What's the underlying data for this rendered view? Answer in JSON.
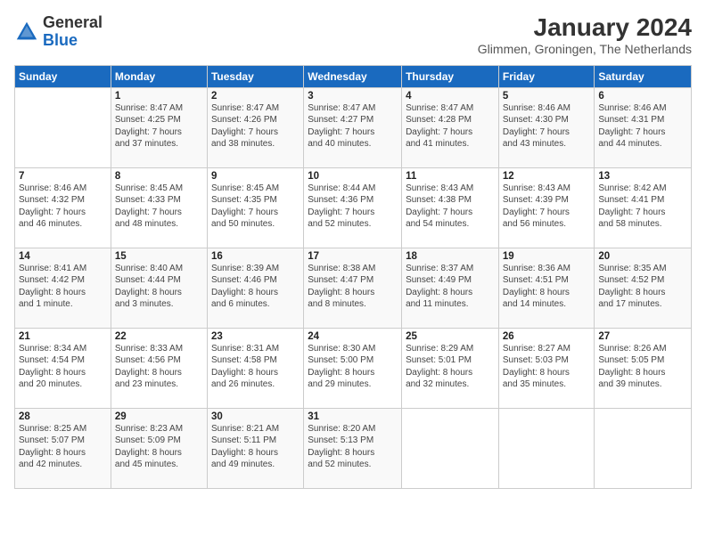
{
  "header": {
    "logo_general": "General",
    "logo_blue": "Blue",
    "title": "January 2024",
    "location": "Glimmen, Groningen, The Netherlands"
  },
  "days_of_week": [
    "Sunday",
    "Monday",
    "Tuesday",
    "Wednesday",
    "Thursday",
    "Friday",
    "Saturday"
  ],
  "weeks": [
    [
      {
        "day": "",
        "info": ""
      },
      {
        "day": "1",
        "info": "Sunrise: 8:47 AM\nSunset: 4:25 PM\nDaylight: 7 hours\nand 37 minutes."
      },
      {
        "day": "2",
        "info": "Sunrise: 8:47 AM\nSunset: 4:26 PM\nDaylight: 7 hours\nand 38 minutes."
      },
      {
        "day": "3",
        "info": "Sunrise: 8:47 AM\nSunset: 4:27 PM\nDaylight: 7 hours\nand 40 minutes."
      },
      {
        "day": "4",
        "info": "Sunrise: 8:47 AM\nSunset: 4:28 PM\nDaylight: 7 hours\nand 41 minutes."
      },
      {
        "day": "5",
        "info": "Sunrise: 8:46 AM\nSunset: 4:30 PM\nDaylight: 7 hours\nand 43 minutes."
      },
      {
        "day": "6",
        "info": "Sunrise: 8:46 AM\nSunset: 4:31 PM\nDaylight: 7 hours\nand 44 minutes."
      }
    ],
    [
      {
        "day": "7",
        "info": "Sunrise: 8:46 AM\nSunset: 4:32 PM\nDaylight: 7 hours\nand 46 minutes."
      },
      {
        "day": "8",
        "info": "Sunrise: 8:45 AM\nSunset: 4:33 PM\nDaylight: 7 hours\nand 48 minutes."
      },
      {
        "day": "9",
        "info": "Sunrise: 8:45 AM\nSunset: 4:35 PM\nDaylight: 7 hours\nand 50 minutes."
      },
      {
        "day": "10",
        "info": "Sunrise: 8:44 AM\nSunset: 4:36 PM\nDaylight: 7 hours\nand 52 minutes."
      },
      {
        "day": "11",
        "info": "Sunrise: 8:43 AM\nSunset: 4:38 PM\nDaylight: 7 hours\nand 54 minutes."
      },
      {
        "day": "12",
        "info": "Sunrise: 8:43 AM\nSunset: 4:39 PM\nDaylight: 7 hours\nand 56 minutes."
      },
      {
        "day": "13",
        "info": "Sunrise: 8:42 AM\nSunset: 4:41 PM\nDaylight: 7 hours\nand 58 minutes."
      }
    ],
    [
      {
        "day": "14",
        "info": "Sunrise: 8:41 AM\nSunset: 4:42 PM\nDaylight: 8 hours\nand 1 minute."
      },
      {
        "day": "15",
        "info": "Sunrise: 8:40 AM\nSunset: 4:44 PM\nDaylight: 8 hours\nand 3 minutes."
      },
      {
        "day": "16",
        "info": "Sunrise: 8:39 AM\nSunset: 4:46 PM\nDaylight: 8 hours\nand 6 minutes."
      },
      {
        "day": "17",
        "info": "Sunrise: 8:38 AM\nSunset: 4:47 PM\nDaylight: 8 hours\nand 8 minutes."
      },
      {
        "day": "18",
        "info": "Sunrise: 8:37 AM\nSunset: 4:49 PM\nDaylight: 8 hours\nand 11 minutes."
      },
      {
        "day": "19",
        "info": "Sunrise: 8:36 AM\nSunset: 4:51 PM\nDaylight: 8 hours\nand 14 minutes."
      },
      {
        "day": "20",
        "info": "Sunrise: 8:35 AM\nSunset: 4:52 PM\nDaylight: 8 hours\nand 17 minutes."
      }
    ],
    [
      {
        "day": "21",
        "info": "Sunrise: 8:34 AM\nSunset: 4:54 PM\nDaylight: 8 hours\nand 20 minutes."
      },
      {
        "day": "22",
        "info": "Sunrise: 8:33 AM\nSunset: 4:56 PM\nDaylight: 8 hours\nand 23 minutes."
      },
      {
        "day": "23",
        "info": "Sunrise: 8:31 AM\nSunset: 4:58 PM\nDaylight: 8 hours\nand 26 minutes."
      },
      {
        "day": "24",
        "info": "Sunrise: 8:30 AM\nSunset: 5:00 PM\nDaylight: 8 hours\nand 29 minutes."
      },
      {
        "day": "25",
        "info": "Sunrise: 8:29 AM\nSunset: 5:01 PM\nDaylight: 8 hours\nand 32 minutes."
      },
      {
        "day": "26",
        "info": "Sunrise: 8:27 AM\nSunset: 5:03 PM\nDaylight: 8 hours\nand 35 minutes."
      },
      {
        "day": "27",
        "info": "Sunrise: 8:26 AM\nSunset: 5:05 PM\nDaylight: 8 hours\nand 39 minutes."
      }
    ],
    [
      {
        "day": "28",
        "info": "Sunrise: 8:25 AM\nSunset: 5:07 PM\nDaylight: 8 hours\nand 42 minutes."
      },
      {
        "day": "29",
        "info": "Sunrise: 8:23 AM\nSunset: 5:09 PM\nDaylight: 8 hours\nand 45 minutes."
      },
      {
        "day": "30",
        "info": "Sunrise: 8:21 AM\nSunset: 5:11 PM\nDaylight: 8 hours\nand 49 minutes."
      },
      {
        "day": "31",
        "info": "Sunrise: 8:20 AM\nSunset: 5:13 PM\nDaylight: 8 hours\nand 52 minutes."
      },
      {
        "day": "",
        "info": ""
      },
      {
        "day": "",
        "info": ""
      },
      {
        "day": "",
        "info": ""
      }
    ]
  ]
}
